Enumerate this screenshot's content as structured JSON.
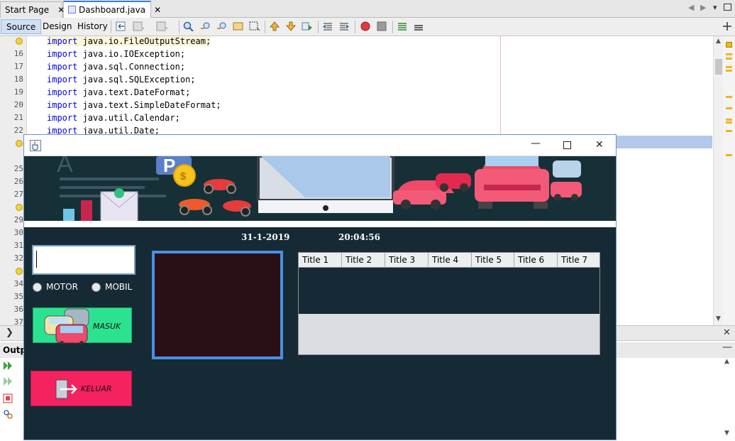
{
  "ide": {
    "tabs": [
      {
        "label": "Start Page",
        "active": false
      },
      {
        "label": "Dashboard.java",
        "active": true
      }
    ],
    "modes": [
      "Source",
      "Design",
      "History"
    ],
    "active_mode": "Source",
    "code_lines": [
      {
        "n": "",
        "kw": "import",
        "rest": " java.io.FileOutputStream;"
      },
      {
        "n": "16",
        "kw": "import",
        "rest": " java.io.IOException;"
      },
      {
        "n": "17",
        "kw": "import",
        "rest": " java.sql.Connection;"
      },
      {
        "n": "18",
        "kw": "import",
        "rest": " java.sql.SQLException;"
      },
      {
        "n": "19",
        "kw": "import",
        "rest": " java.text.DateFormat;"
      },
      {
        "n": "20",
        "kw": "import",
        "rest": " java.text.SimpleDateFormat;"
      },
      {
        "n": "21",
        "kw": "import",
        "rest": " java.util.Calendar;"
      },
      {
        "n": "22",
        "kw": "import",
        "rest": " java.util.Date;"
      }
    ],
    "hidden_line_numbers": [
      "",
      "25",
      "26",
      "27",
      "",
      "29",
      "30",
      "31",
      "32",
      "",
      "34",
      "35",
      "36",
      "37"
    ],
    "output_tab_label": "Outpu"
  },
  "app": {
    "date": "31-1-2019",
    "time": "20:04:56",
    "plate_value": "",
    "radio_options": [
      "MOTOR",
      "MOBIL"
    ],
    "masuk_label": "MASUK",
    "keluar_label": "KELUAR",
    "table_headers": [
      "Title 1",
      "Title 2",
      "Title 3",
      "Title 4",
      "Title 5",
      "Title 6",
      "Title 7"
    ],
    "colors": {
      "background": "#152a35",
      "masuk": "#2be38f",
      "keluar": "#f5225f",
      "camera_border": "#4a90e2"
    }
  }
}
